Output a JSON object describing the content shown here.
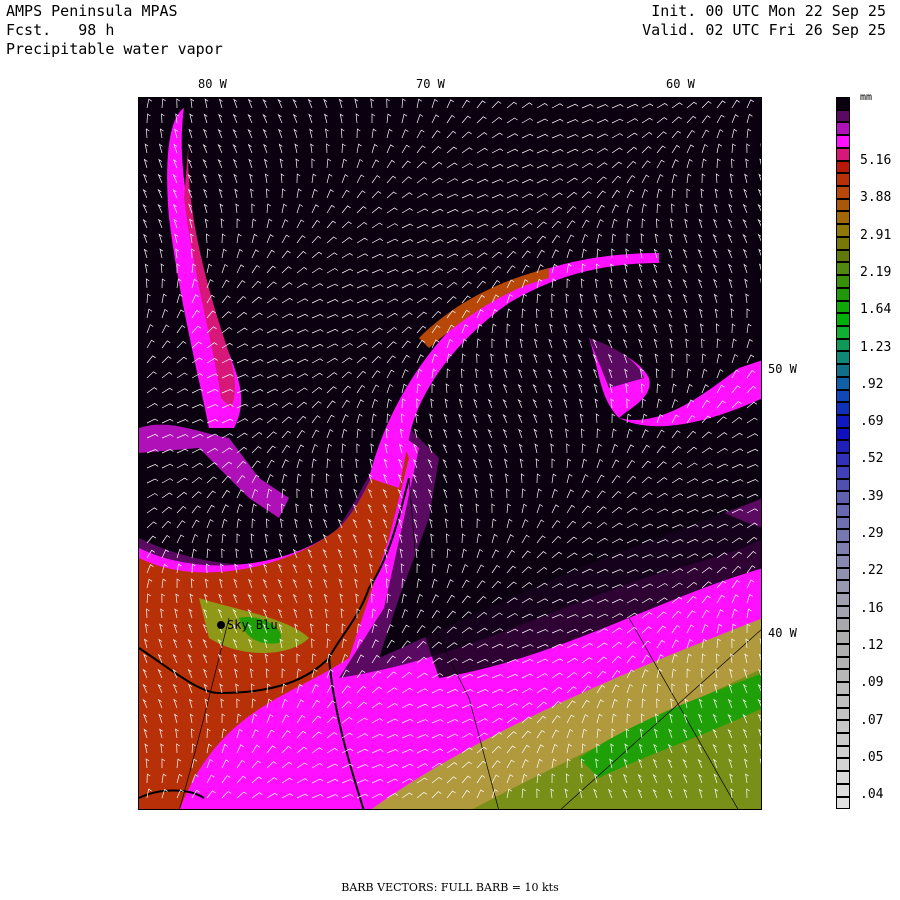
{
  "header": {
    "model": "AMPS Peninsula MPAS",
    "forecast": "Fcst.   98 h",
    "field": "Precipitable water vapor",
    "init": "Init. 00 UTC Mon 22 Sep 25",
    "valid": "Valid. 02 UTC Fri 26 Sep 25"
  },
  "axes": {
    "lon_labels": [
      "80 W",
      "70 W",
      "60 W"
    ],
    "lat_labels": [
      "50 W",
      "40 W"
    ]
  },
  "station": {
    "name": "Sky Blu"
  },
  "colorbar": {
    "unit": "mm",
    "labels": [
      "5.16",
      "3.88",
      "2.91",
      "2.19",
      "1.64",
      "1.23",
      ".92",
      ".69",
      ".52",
      ".39",
      ".29",
      ".22",
      ".16",
      ".12",
      ".09",
      ".07",
      ".05",
      ".04"
    ],
    "colors": [
      "#0a0010",
      "#5a0a60",
      "#b010b8",
      "#ff10ff",
      "#d81878",
      "#b81808",
      "#b83008",
      "#b84808",
      "#a85808",
      "#a06808",
      "#907808",
      "#787808",
      "#607808",
      "#508810",
      "#389008",
      "#209808",
      "#10a808",
      "#00b008",
      "#10b030",
      "#109858",
      "#108878",
      "#107088",
      "#1060a8",
      "#1048b8",
      "#1030b8",
      "#1018c0",
      "#1010c0",
      "#2020b8",
      "#3030b8",
      "#4040b8",
      "#5050b0",
      "#6060b0",
      "#6868b0",
      "#7070b0",
      "#7878b0",
      "#8080b0",
      "#8888b0",
      "#9090b0",
      "#9898b0",
      "#a0a0b0",
      "#a4a4b0",
      "#a8a8ae",
      "#acacac",
      "#b0b0b0",
      "#b4b4b4",
      "#b8b8b8",
      "#bcbcbc",
      "#c0c0c0",
      "#c4c4c4",
      "#c8c8c8",
      "#cccccc",
      "#d0d0d0",
      "#d4d4d4",
      "#d8d8d8",
      "#dcdcdc",
      "#e0e0e0"
    ]
  },
  "footer": "BARB VECTORS:  FULL BARB = 10 kts"
}
